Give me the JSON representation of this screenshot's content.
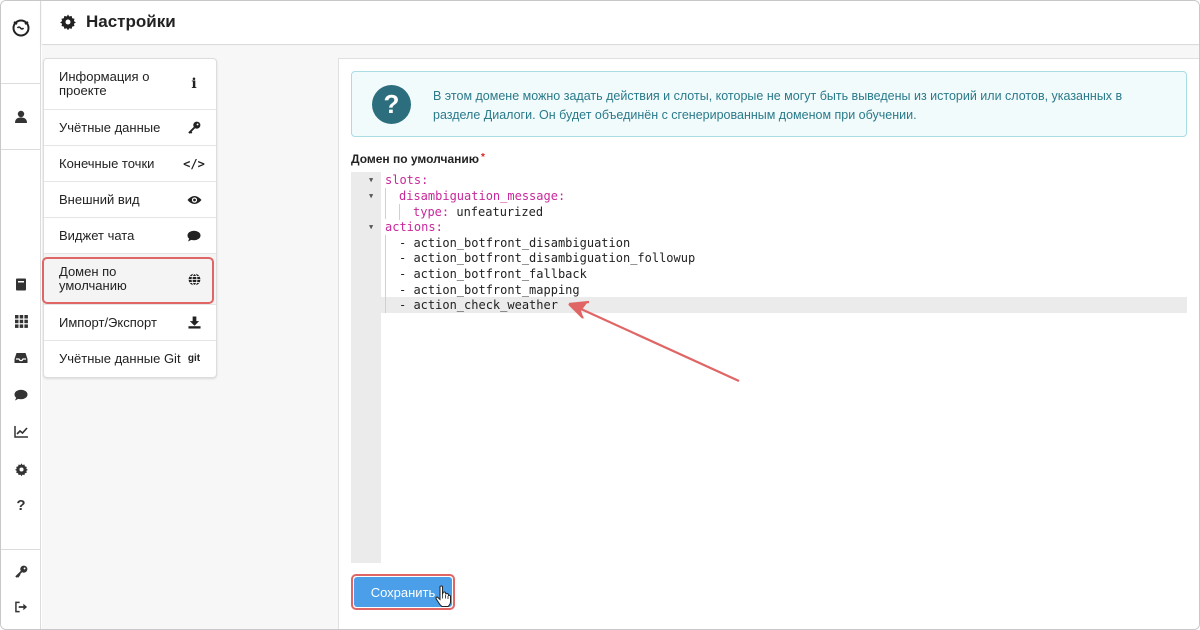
{
  "header": {
    "title": "Настройки"
  },
  "rail": {
    "items": [
      "logo-icon",
      "user-icon",
      "book-icon",
      "grid-icon",
      "inbox-icon",
      "chat-icon",
      "chart-icon",
      "gear-icon",
      "help-icon",
      "key-icon",
      "logout-icon"
    ],
    "help_glyph": "?"
  },
  "menu": {
    "items": [
      {
        "label": "Информация о проекте",
        "icon": "info-icon",
        "glyph": "i"
      },
      {
        "label": "Учётные данные",
        "icon": "key-icon"
      },
      {
        "label": "Конечные точки",
        "icon": "code-icon",
        "glyph": "</>"
      },
      {
        "label": "Внешний вид",
        "icon": "eye-icon"
      },
      {
        "label": "Виджет чата",
        "icon": "chat-icon"
      },
      {
        "label": "Домен по умолчанию",
        "icon": "globe-icon",
        "active": true
      },
      {
        "label": "Импорт/Экспорт",
        "icon": "download-icon"
      },
      {
        "label": "Учётные данные Git",
        "icon": "git-icon",
        "glyph": "git"
      }
    ]
  },
  "info": {
    "icon_glyph": "?",
    "text": "В этом домене можно задать действия и слоты, которые не могут быть выведены из историй или слотов, указанных в разделе Диалоги. Он будет объединён с сгенерированным доменом при обучении."
  },
  "field": {
    "label": "Домен по умолчанию",
    "required_mark": "*"
  },
  "editor": {
    "lines": [
      {
        "key": "slots:",
        "value": "",
        "fold": true
      },
      {
        "key": "disambiguation_message:",
        "value": "",
        "fold": true
      },
      {
        "key": "type:",
        "value": " unfeaturized",
        "fold": false
      },
      {
        "key": "actions:",
        "value": "",
        "fold": true
      },
      {
        "key": "",
        "value": "- action_botfront_disambiguation",
        "fold": false
      },
      {
        "key": "",
        "value": "- action_botfront_disambiguation_followup",
        "fold": false
      },
      {
        "key": "",
        "value": "- action_botfront_fallback",
        "fold": false
      },
      {
        "key": "",
        "value": "- action_botfront_mapping",
        "fold": false
      },
      {
        "key": "",
        "value": "- action_check_weather",
        "fold": false,
        "active": true
      }
    ]
  },
  "save_button": {
    "label": "Сохранить"
  },
  "colors": {
    "accent": "#4a9fe8",
    "highlight": "#e06666",
    "yaml_key": "#c8289a",
    "info_text": "#2a7a8a"
  }
}
